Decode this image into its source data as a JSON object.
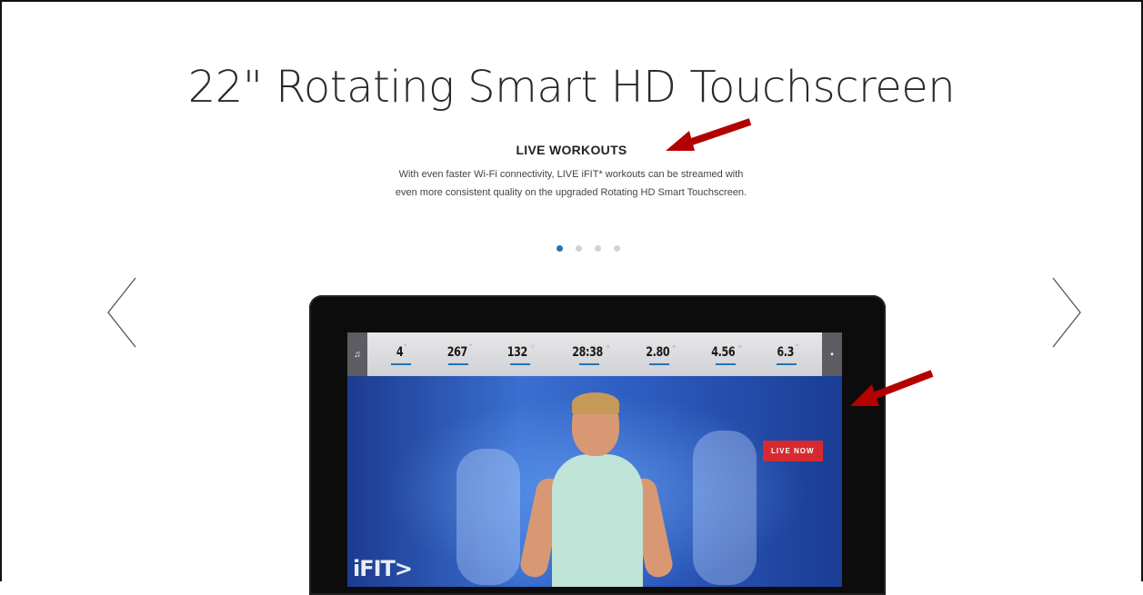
{
  "heading": {
    "title": "22\" Rotating Smart HD Touchscreen",
    "subtitle": "LIVE WORKOUTS",
    "description": "With even faster Wi-Fi connectivity, LIVE iFIT* workouts can be streamed with even more consistent quality on the upgraded Rotating HD Smart Touchscreen."
  },
  "carousel": {
    "dot_count": 4,
    "active_index": 0,
    "prev_icon": "chevron-left-icon",
    "next_icon": "chevron-right-icon"
  },
  "screen": {
    "stats": [
      {
        "value": "4",
        "label": "INCLINE"
      },
      {
        "value": "267",
        "label": "CALORIES BURNED"
      },
      {
        "value": "132",
        "label": "HEART RATE"
      },
      {
        "value": "28:38",
        "label": "TIME"
      },
      {
        "value": "2.80",
        "label": "DISTANCE"
      },
      {
        "value": "4.56",
        "label": "PACE"
      },
      {
        "value": "6.3",
        "label": "SPEED"
      }
    ],
    "badge": "LIVE NOW",
    "brand": "iFIT>"
  },
  "colors": {
    "accent": "#1f74b8",
    "live": "#d72a30",
    "callout_arrow": "#b30000"
  }
}
